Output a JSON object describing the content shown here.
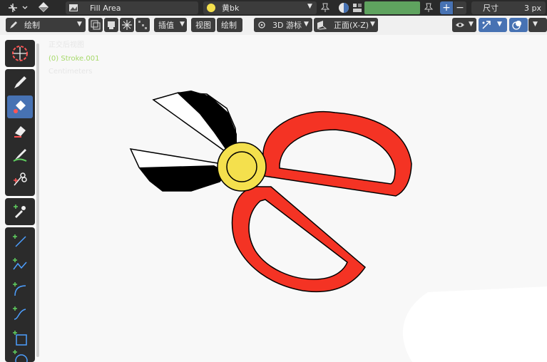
{
  "top": {
    "fill_area_label": "Fill Area",
    "material_name": "黄bk",
    "material_color": "#f4e04d",
    "color_swatch": "#5fa35f",
    "size_label": "尺寸",
    "size_value": "3 px"
  },
  "header": {
    "mode_label": "绘制",
    "interp_label": "插值",
    "view_menu": "视图",
    "draw_menu": "绘制",
    "cursor_label": "3D 游标",
    "view_axis": "正面(X-Z)"
  },
  "overlay": {
    "view_name": "正交后视图",
    "object_name": "(0) Stroke.001",
    "units": "Centimeters"
  },
  "colors": {
    "accent": "#4772b3",
    "handle_red": "#f43324",
    "pivot_yellow": "#f4e04d",
    "blade_black": "#000000",
    "object_green": "#a6d96a"
  },
  "icons": {
    "tools": [
      "cursor-icon",
      "draw-icon",
      "fill-icon",
      "erase-icon",
      "tint-icon",
      "cutter-icon",
      "eyedropper-icon",
      "line-icon",
      "polyline-icon",
      "arc-icon",
      "curve-icon",
      "box-icon",
      "circle-icon"
    ]
  }
}
